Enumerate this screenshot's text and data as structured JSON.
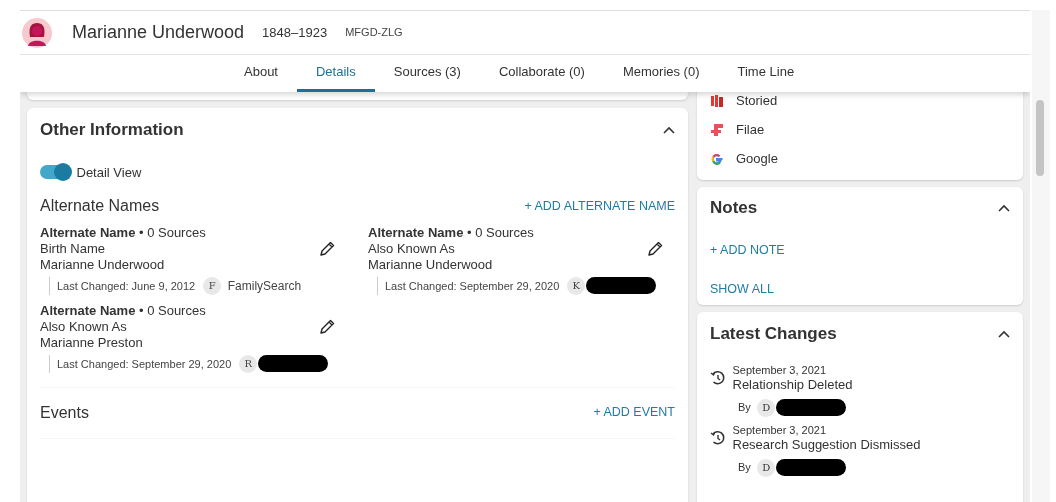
{
  "person": {
    "name": "Marianne Underwood",
    "dates": "1848–1923",
    "pid": "MFGD-ZLG"
  },
  "tabs": [
    {
      "label": "About",
      "selected": false
    },
    {
      "label": "Details",
      "selected": true
    },
    {
      "label": "Sources (3)",
      "selected": false
    },
    {
      "label": "Collaborate (0)",
      "selected": false
    },
    {
      "label": "Memories (0)",
      "selected": false
    },
    {
      "label": "Time Line",
      "selected": false
    }
  ],
  "other_information": {
    "title": "Other Information",
    "expanded": true,
    "detail_view": {
      "label": "Detail View",
      "on": true
    },
    "alternate_names": {
      "title": "Alternate Names",
      "add_label": "+  ADD ALTERNATE NAME",
      "items": [
        {
          "heading": "**Alternate Name** • 0 Sources",
          "name_type": "Birth Name",
          "name": "Marianne Underwood",
          "last_changed": "Last Changed: June 9, 2012",
          "contributor": {
            "initial": "F",
            "name": "FamilySearch",
            "redacted": false
          }
        },
        {
          "heading": "**Alternate Name** • 0 Sources",
          "name_type": "Also Known As",
          "name": "Marianne Underwood",
          "last_changed": "Last Changed: September 29, 2020",
          "contributor": {
            "initial": "K",
            "redacted": true
          }
        },
        {
          "heading": "**Alternate Name** • 0 Sources",
          "name_type": "Also Known As",
          "name": "Marianne Preston",
          "last_changed": "Last Changed: September 29, 2020",
          "contributor": {
            "initial": "R",
            "redacted": true
          }
        }
      ]
    },
    "events": {
      "title": "Events",
      "add_label": "+  ADD EVENT"
    }
  },
  "research_links": [
    {
      "label": "Storied",
      "kind": "storied"
    },
    {
      "label": "Filae",
      "kind": "filae"
    },
    {
      "label": "Google",
      "kind": "google"
    }
  ],
  "notes": {
    "title": "Notes",
    "expanded": true,
    "add_label": "+  ADD NOTE",
    "show_all": "SHOW ALL"
  },
  "latest_changes": {
    "title": "Latest Changes",
    "expanded": true,
    "items": [
      {
        "date": "September 3, 2021",
        "title": "Relationship Deleted",
        "by": "By",
        "initial": "D",
        "redacted": true
      },
      {
        "date": "September 3, 2021",
        "title": "Research Suggestion Dismissed",
        "by": "By",
        "initial": "D",
        "redacted": true
      }
    ]
  }
}
